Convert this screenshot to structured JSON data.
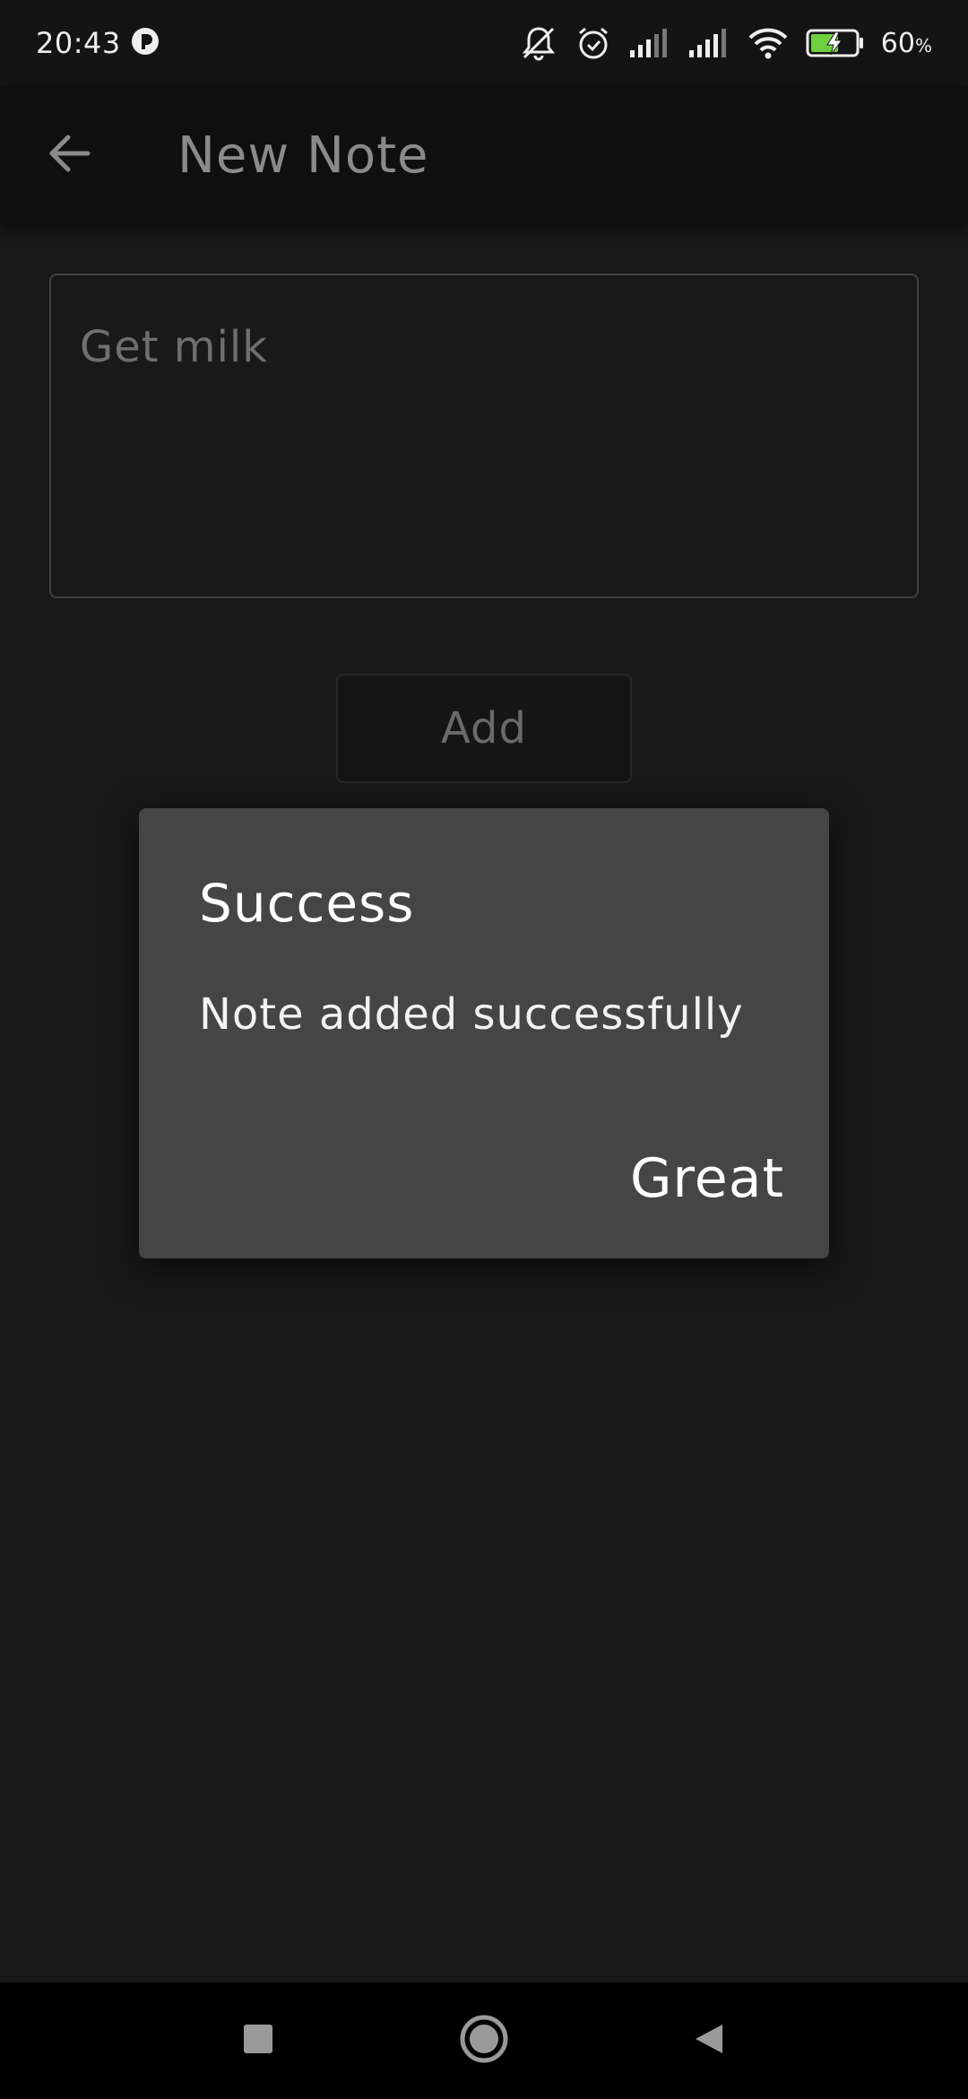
{
  "status_bar": {
    "time": "20:43",
    "battery_percent": "60",
    "battery_unit": "%",
    "icons": [
      "notification-dot-icon",
      "mute-icon",
      "alarm-icon",
      "signal-icon",
      "signal-icon",
      "wifi-icon",
      "battery-charging-icon"
    ]
  },
  "app_bar": {
    "title": "New Note",
    "back_icon": "arrow-left-icon"
  },
  "note_input": {
    "value": "Get milk"
  },
  "add_button": {
    "label": "Add"
  },
  "dialog": {
    "title": "Success",
    "message": "Note added successfully",
    "action_label": "Great"
  },
  "nav_bar": {
    "icons": [
      "recents-square-icon",
      "home-circle-icon",
      "back-triangle-icon"
    ]
  },
  "colors": {
    "background": "#181818",
    "app_bar": "#0f0f0f",
    "dialog": "#454545",
    "battery_green": "#6fcf3f"
  }
}
